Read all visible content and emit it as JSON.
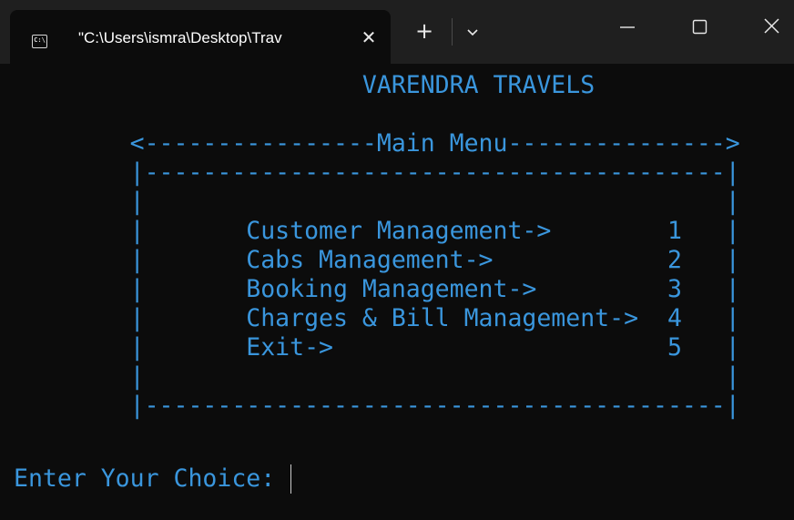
{
  "window": {
    "tab_icon": "C:\\",
    "tab_title": "\"C:\\Users\\ismra\\Desktop\\Trav",
    "tab_close_glyph": "✕",
    "new_tab_glyph": "+",
    "icons": {
      "tab": "console-icon",
      "close_tab": "close-icon",
      "new_tab": "plus-icon",
      "dropdown": "chevron-down-icon",
      "minimize": "minimize-icon",
      "maximize": "maximize-icon",
      "close_window": "close-icon"
    }
  },
  "console": {
    "text_color": "#3a96dd",
    "background": "#0c0c0c",
    "lines": [
      "                        VARENDRA TRAVELS",
      "",
      "        <----------------Main Menu--------------->",
      "        |----------------------------------------|",
      "        |                                        |",
      "        |       Customer Management->        1   |",
      "        |       Cabs Management->            2   |",
      "        |       Booking Management->         3   |",
      "        |       Charges & Bill Management->  4   |",
      "        |       Exit->                       5   |",
      "        |                                        |",
      "        |----------------------------------------|",
      "",
      "Enter Your Choice: "
    ]
  }
}
